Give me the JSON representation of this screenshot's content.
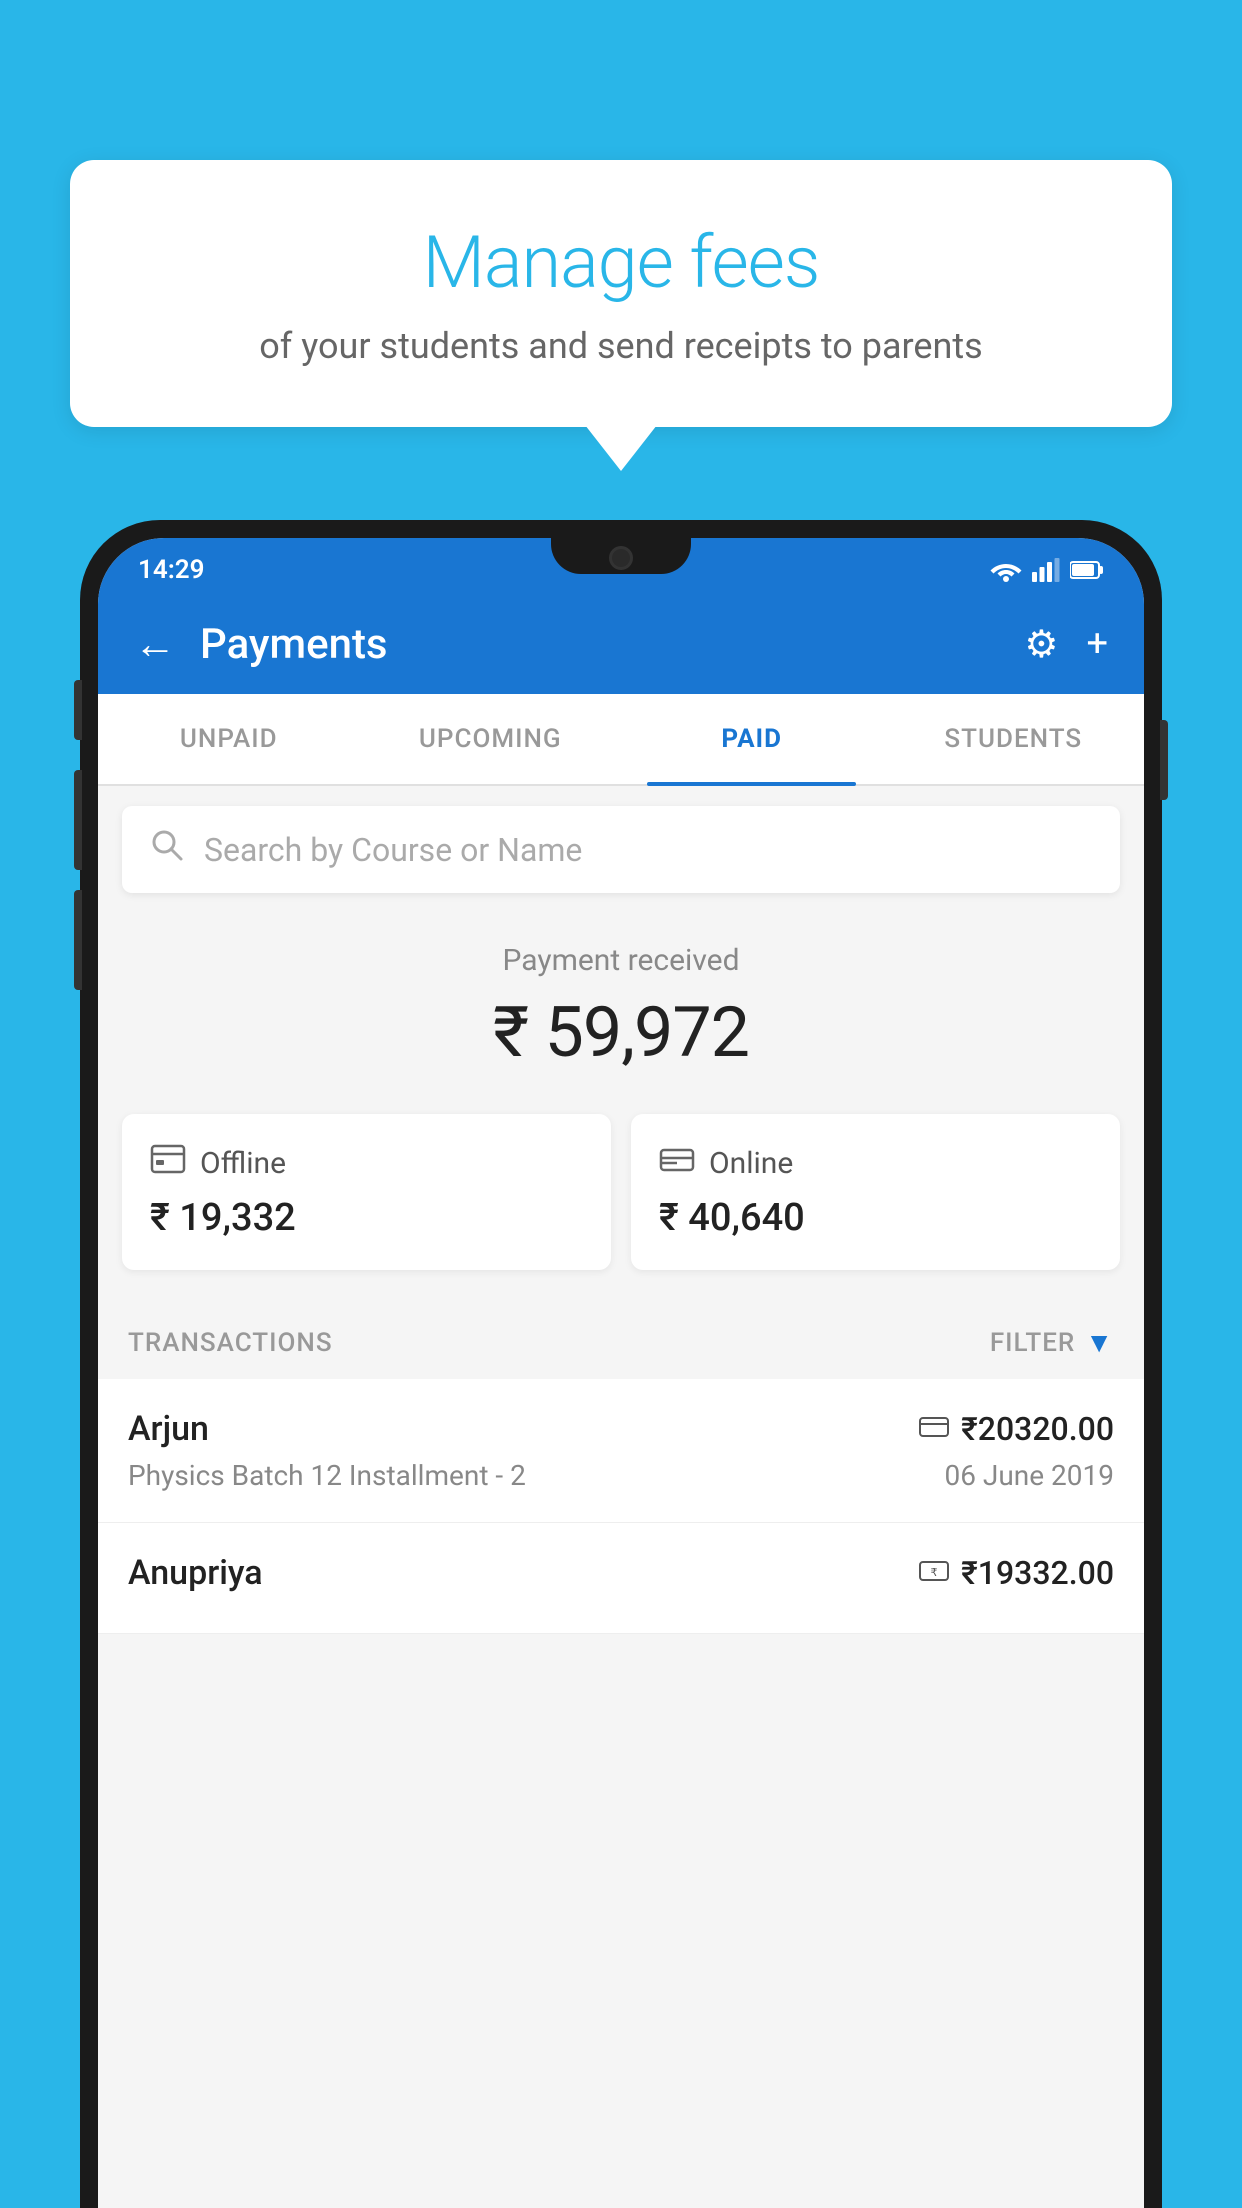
{
  "background_color": "#29b6e8",
  "speech_bubble": {
    "title": "Manage fees",
    "subtitle": "of your students and send receipts to parents"
  },
  "status_bar": {
    "time": "14:29",
    "wifi": "▼",
    "signal": "▲",
    "battery": "▐"
  },
  "header": {
    "title": "Payments",
    "back_icon": "←",
    "settings_icon": "⚙",
    "add_icon": "+"
  },
  "tabs": [
    {
      "label": "UNPAID",
      "active": false
    },
    {
      "label": "UPCOMING",
      "active": false
    },
    {
      "label": "PAID",
      "active": true
    },
    {
      "label": "STUDENTS",
      "active": false
    }
  ],
  "search": {
    "placeholder": "Search by Course or Name"
  },
  "payment_received": {
    "label": "Payment received",
    "amount": "₹ 59,972",
    "offline": {
      "type": "Offline",
      "amount": "₹ 19,332"
    },
    "online": {
      "type": "Online",
      "amount": "₹ 40,640"
    }
  },
  "transactions": {
    "header_label": "TRANSACTIONS",
    "filter_label": "FILTER",
    "items": [
      {
        "name": "Arjun",
        "course": "Physics Batch 12 Installment - 2",
        "amount": "₹20320.00",
        "date": "06 June 2019",
        "payment_type": "card"
      },
      {
        "name": "Anupriya",
        "course": "",
        "amount": "₹19332.00",
        "date": "",
        "payment_type": "cash"
      }
    ]
  }
}
